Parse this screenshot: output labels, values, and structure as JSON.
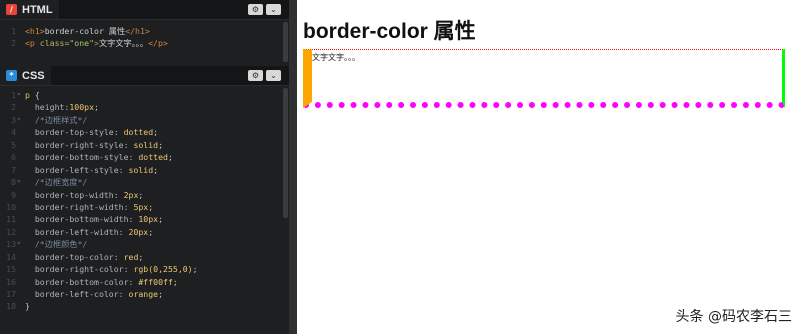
{
  "html_panel": {
    "title": "HTML",
    "badge_color": "#e8443a",
    "code": [
      {
        "n": "1",
        "segments": [
          [
            "tag",
            "<h1>"
          ],
          [
            "plain",
            "border-color 属性"
          ],
          [
            "tag",
            "</h1>"
          ]
        ]
      },
      {
        "n": "2",
        "segments": [
          [
            "tag",
            "<p "
          ],
          [
            "attr",
            "class="
          ],
          [
            "str",
            "\"one\""
          ],
          [
            "tag",
            ">"
          ],
          [
            "plain",
            "文字文字。。。"
          ],
          [
            "tag",
            "</p>"
          ]
        ]
      }
    ]
  },
  "css_panel": {
    "title": "CSS",
    "badge_color": "#2a8cd8",
    "code": [
      {
        "n": "1",
        "fold": "-",
        "segments": [
          [
            "sel",
            "p "
          ],
          [
            "punc",
            "{"
          ]
        ]
      },
      {
        "n": "2",
        "segments": [
          [
            "prop",
            "  height:"
          ],
          [
            "val",
            "100px"
          ],
          [
            "punc",
            ";"
          ]
        ]
      },
      {
        "n": "3",
        "fold": "-",
        "segments": [
          [
            "cmt",
            "  /*边框样式*/"
          ]
        ]
      },
      {
        "n": "4",
        "segments": [
          [
            "prop",
            "  border-top-style: "
          ],
          [
            "val",
            "dotted"
          ],
          [
            "punc",
            ";"
          ]
        ]
      },
      {
        "n": "5",
        "segments": [
          [
            "prop",
            "  border-right-style: "
          ],
          [
            "val",
            "solid"
          ],
          [
            "punc",
            ";"
          ]
        ]
      },
      {
        "n": "6",
        "segments": [
          [
            "prop",
            "  border-bottom-style: "
          ],
          [
            "val",
            "dotted"
          ],
          [
            "punc",
            ";"
          ]
        ]
      },
      {
        "n": "7",
        "segments": [
          [
            "prop",
            "  border-left-style: "
          ],
          [
            "val",
            "solid"
          ],
          [
            "punc",
            ";"
          ]
        ]
      },
      {
        "n": "8",
        "fold": "-",
        "segments": [
          [
            "cmt",
            "  /*边框宽度*/"
          ]
        ]
      },
      {
        "n": "9",
        "segments": [
          [
            "prop",
            "  border-top-width: "
          ],
          [
            "val",
            "2px"
          ],
          [
            "punc",
            ";"
          ]
        ]
      },
      {
        "n": "10",
        "segments": [
          [
            "prop",
            "  border-right-width: "
          ],
          [
            "val",
            "5px"
          ],
          [
            "punc",
            ";"
          ]
        ]
      },
      {
        "n": "11",
        "segments": [
          [
            "prop",
            "  border-bottom-width: "
          ],
          [
            "val",
            "10px"
          ],
          [
            "punc",
            ";"
          ]
        ]
      },
      {
        "n": "12",
        "segments": [
          [
            "prop",
            "  border-left-width: "
          ],
          [
            "val",
            "20px"
          ],
          [
            "punc",
            ";"
          ]
        ]
      },
      {
        "n": "13",
        "fold": "-",
        "segments": [
          [
            "cmt",
            "  /*边框颜色*/"
          ]
        ]
      },
      {
        "n": "14",
        "segments": [
          [
            "prop",
            "  border-top-color: "
          ],
          [
            "val",
            "red"
          ],
          [
            "punc",
            ";"
          ]
        ]
      },
      {
        "n": "15",
        "segments": [
          [
            "prop",
            "  border-right-color: "
          ],
          [
            "val",
            "rgb(0,255,0)"
          ],
          [
            "punc",
            ";"
          ]
        ]
      },
      {
        "n": "16",
        "segments": [
          [
            "prop",
            "  border-bottom-color: "
          ],
          [
            "val",
            "#ff00ff"
          ],
          [
            "punc",
            ";"
          ]
        ]
      },
      {
        "n": "17",
        "segments": [
          [
            "prop",
            "  border-left-color: "
          ],
          [
            "val",
            "orange"
          ],
          [
            "punc",
            ";"
          ]
        ]
      },
      {
        "n": "18",
        "segments": [
          [
            "punc",
            "}"
          ]
        ]
      }
    ]
  },
  "preview": {
    "heading": "border-color 属性",
    "paragraph": "文字文字。。。"
  },
  "watermark": "头条 @码农李石三"
}
